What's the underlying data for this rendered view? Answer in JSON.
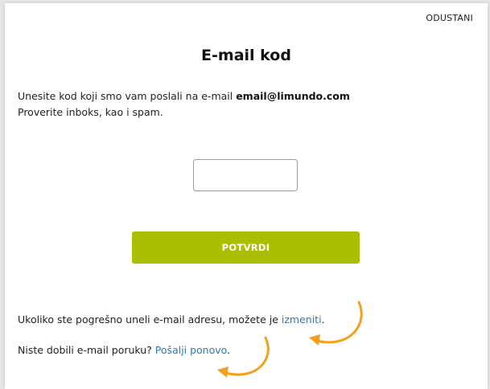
{
  "modal": {
    "cancel_label": "ODUSTANI",
    "title": "E-mail kod",
    "intro": {
      "line1_prefix": "Unesite kod koji smo vam poslali na e-mail ",
      "email": "email@limundo.com",
      "line2": "Proverite inboks, kao i spam."
    },
    "code_input": {
      "value": "",
      "placeholder": ""
    },
    "confirm_label": "POTVRDI",
    "change_email": {
      "prefix": "Ukoliko ste pogrešno uneli e-mail adresu, možete je ",
      "link": "izmeniti",
      "suffix": "."
    },
    "resend": {
      "prefix": "Niste dobili e-mail poruku? ",
      "link": "Pošalji ponovo",
      "suffix": "."
    }
  },
  "colors": {
    "confirm_button": "#a9bf00",
    "link": "#2a7ab8",
    "annotation_arrow": "#f5a01a"
  },
  "icons": {
    "arrow1": "curved-arrow-icon",
    "arrow2": "curved-arrow-icon"
  }
}
